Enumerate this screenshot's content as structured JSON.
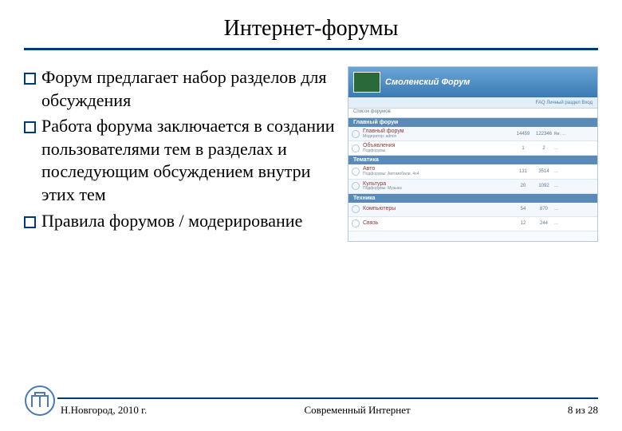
{
  "title": "Интернет-форумы",
  "bullets": [
    "Форум предлагает набор разделов для обсуждения",
    "Работа форума заключается в создании пользователями тем в разделах и последующим обсуждением внутри этих тем",
    "Правила форумов / модерирование"
  ],
  "forum": {
    "title": "Смоленский Форум",
    "nav": "FAQ  Личный раздел  Вход",
    "breadcrumb": "Список форумов",
    "sections": [
      {
        "head": "Главный форум",
        "rows": [
          {
            "topic": "Главный форум",
            "meta": "Модератор: admin",
            "n1": "14459",
            "n2": "122346",
            "last": "Re: …"
          },
          {
            "topic": "Объявления",
            "meta": "Подфорумы",
            "n1": "1",
            "n2": "2",
            "last": "…"
          }
        ]
      },
      {
        "head": "Тематика",
        "rows": [
          {
            "topic": "Авто",
            "meta": "Подфорумы: Автомобили, 4х4",
            "n1": "131",
            "n2": "3514",
            "last": "…"
          },
          {
            "topic": "Культура",
            "meta": "Подфорумы: Музыка",
            "n1": "20",
            "n2": "1092",
            "last": "…"
          }
        ]
      },
      {
        "head": "Техника",
        "rows": [
          {
            "topic": "Компьютеры",
            "meta": "",
            "n1": "54",
            "n2": "870",
            "last": "…"
          },
          {
            "topic": "Связь",
            "meta": "",
            "n1": "12",
            "n2": "244",
            "last": "…"
          }
        ]
      }
    ]
  },
  "footer": {
    "left": "Н.Новгород, 2010 г.",
    "center": "Современный Интернет",
    "right_prefix": "8 из ",
    "right_total": "28"
  }
}
